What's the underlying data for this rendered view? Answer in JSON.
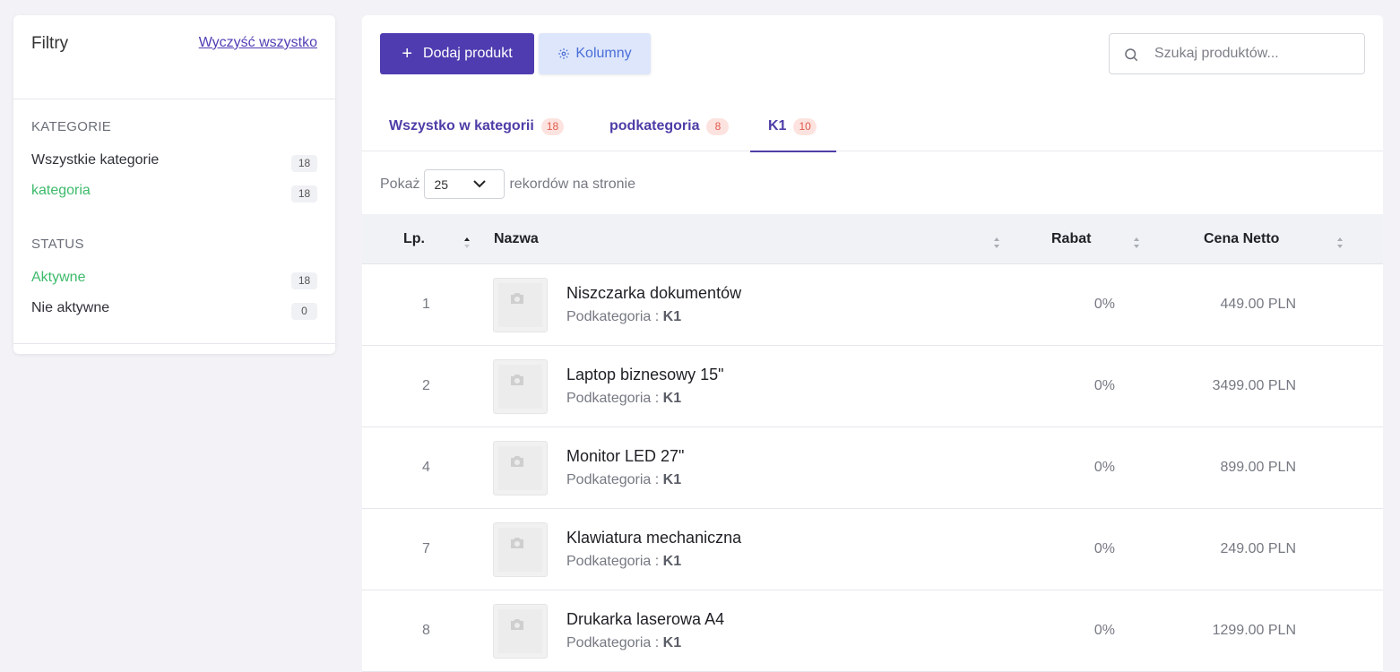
{
  "filters": {
    "title": "Filtry",
    "clear_all": "Wyczyść wszystko",
    "categories": {
      "title": "KATEGORIE",
      "items": [
        {
          "label": "Wszystkie kategorie",
          "count": "18"
        },
        {
          "label": "kategoria",
          "count": "18"
        }
      ]
    },
    "status": {
      "title": "STATUS",
      "items": [
        {
          "label": "Aktywne",
          "count": "18"
        },
        {
          "label": "Nie aktywne",
          "count": "0"
        }
      ]
    }
  },
  "toolbar": {
    "add_label": "Dodaj produkt",
    "columns_label": "Kolumny",
    "search_placeholder": "Szukaj produktów..."
  },
  "tabs": [
    {
      "label": "Wszystko w kategorii",
      "count": "18"
    },
    {
      "label": "podkategoria",
      "count": "8"
    },
    {
      "label": "K1",
      "count": "10"
    }
  ],
  "pagination": {
    "show_label": "Pokaż",
    "page_size": "25",
    "suffix": "rekordów na stronie"
  },
  "table": {
    "headers": {
      "lp": "Lp.",
      "name": "Nazwa",
      "discount": "Rabat",
      "price": "Cena Netto"
    },
    "rows": [
      {
        "lp": "1",
        "name": "Niszczarka dokumentów",
        "sub_label": "Podkategoria :",
        "sub_value": "K1",
        "discount": "0%",
        "price": "449.00 PLN"
      },
      {
        "lp": "2",
        "name": "Laptop biznesowy 15\"",
        "sub_label": "Podkategoria :",
        "sub_value": "K1",
        "discount": "0%",
        "price": "3499.00 PLN"
      },
      {
        "lp": "4",
        "name": "Monitor LED 27\"",
        "sub_label": "Podkategoria :",
        "sub_value": "K1",
        "discount": "0%",
        "price": "899.00 PLN"
      },
      {
        "lp": "7",
        "name": "Klawiatura mechaniczna",
        "sub_label": "Podkategoria :",
        "sub_value": "K1",
        "discount": "0%",
        "price": "249.00 PLN"
      },
      {
        "lp": "8",
        "name": "Drukarka laserowa A4",
        "sub_label": "Podkategoria :",
        "sub_value": "K1",
        "discount": "0%",
        "price": "1299.00 PLN"
      }
    ]
  },
  "colors": {
    "primary": "#4f3cb0",
    "green": "#3dba6b",
    "badge_bg": "#fde3df",
    "badge_text": "#e05a4e"
  }
}
